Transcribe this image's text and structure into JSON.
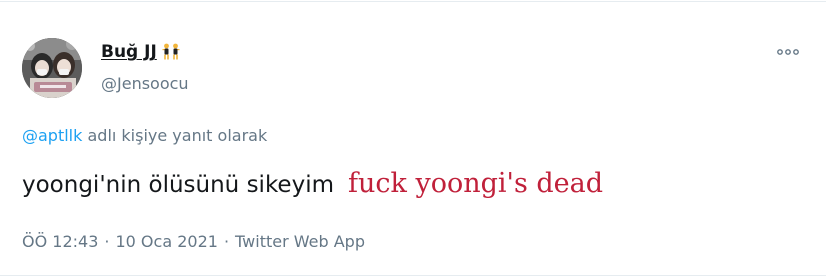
{
  "user": {
    "display_name": "Buğ JJ",
    "name_emoji": "two-dancing-figures-emoji",
    "handle": "@Jensoocu"
  },
  "reply": {
    "mention": "@aptllk",
    "text": " adlı kişiye yanıt olarak"
  },
  "tweet": {
    "text": "yoongi'nin ölüsünü sikeyim",
    "translation": "fuck yoongi's dead"
  },
  "meta": {
    "time": "ÖÖ 12:43",
    "separator1": "·",
    "date": "10 Oca 2021",
    "separator2": "·",
    "source": "Twitter Web App"
  },
  "icons": {
    "more": "more-horizontal-icon",
    "avatar": "profile-avatar"
  },
  "colors": {
    "text_primary": "#14171a",
    "text_secondary": "#657786",
    "link": "#1da1f2",
    "translation": "#c0203a",
    "divider": "#e6ecf0"
  }
}
